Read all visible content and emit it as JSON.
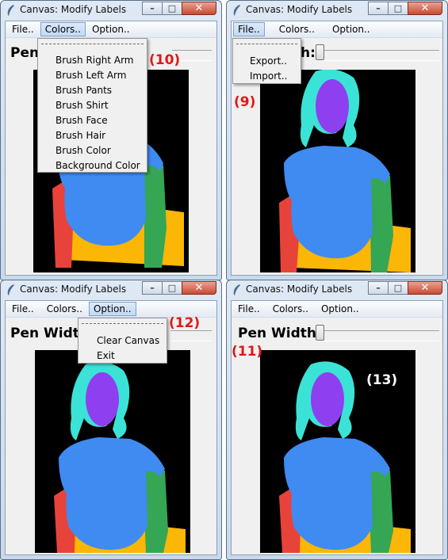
{
  "window_title": "Canvas: Modify Labels",
  "menu": {
    "file": "File..",
    "colors": "Colors..",
    "option": "Option.."
  },
  "pen_width_label": "Pen Width:",
  "pen_width_label_truncated": "Pen",
  "pen_width_label_cut": "Pen Width",
  "pen_width_label_tail": "h:",
  "colors_menu": [
    "Brush Right Arm",
    "Brush Left Arm",
    "Brush Pants",
    "Brush Shirt",
    "Brush Face",
    "Brush Hair",
    "Brush Color",
    "Background Color"
  ],
  "file_menu": [
    "Export..",
    "Import.."
  ],
  "option_menu": [
    "Clear Canvas",
    "Exit"
  ],
  "annotations": {
    "colors_menu": "(10)",
    "file_menu": "(9)",
    "option_menu": "(12)",
    "pen_width": "(11)",
    "canvas": "(13)"
  },
  "colors": {
    "hair": "#3be3d6",
    "face": "#8e3ff0",
    "shirt": "#3f8bf2",
    "right_arm": "#e8433a",
    "left_arm": "#35a653",
    "pants": "#fbb606",
    "background": "#000000"
  }
}
